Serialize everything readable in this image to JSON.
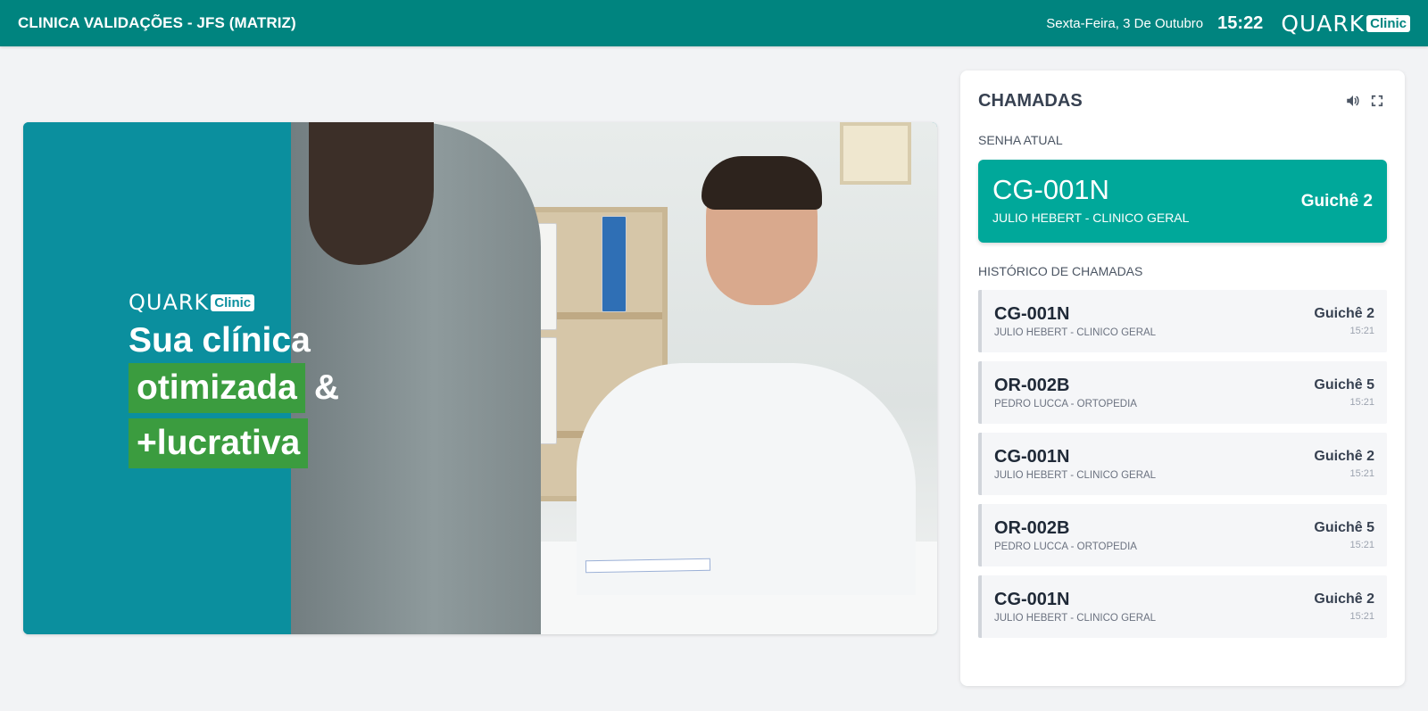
{
  "header": {
    "clinic_name": "CLINICA VALIDAÇÕES - JFS (MATRIZ)",
    "date": "Sexta-Feira, 3 De Outubro",
    "time": "15:22",
    "logo_word": "QUARK",
    "logo_pill": "Clinic"
  },
  "banner": {
    "logo_word": "QUARK",
    "logo_pill": "Clinic",
    "line1": "Sua clínica",
    "line2_highlight": "otimizada",
    "line2_suffix": "&",
    "line3_highlight": "+lucrativa"
  },
  "calls": {
    "title": "CHAMADAS",
    "current_label": "SENHA ATUAL",
    "current": {
      "code": "CG-001N",
      "doctor": "JULIO HEBERT - CLINICO GERAL",
      "window": "Guichê 2"
    },
    "history_label": "HISTÓRICO DE CHAMADAS",
    "history": [
      {
        "code": "CG-001N",
        "doctor": "JULIO HEBERT - CLINICO GERAL",
        "window": "Guichê 2",
        "time": "15:21"
      },
      {
        "code": "OR-002B",
        "doctor": "PEDRO LUCCA - ORTOPEDIA",
        "window": "Guichê 5",
        "time": "15:21"
      },
      {
        "code": "CG-001N",
        "doctor": "JULIO HEBERT - CLINICO GERAL",
        "window": "Guichê 2",
        "time": "15:21"
      },
      {
        "code": "OR-002B",
        "doctor": "PEDRO LUCCA - ORTOPEDIA",
        "window": "Guichê 5",
        "time": "15:21"
      },
      {
        "code": "CG-001N",
        "doctor": "JULIO HEBERT - CLINICO GERAL",
        "window": "Guichê 2",
        "time": "15:21"
      }
    ]
  },
  "icons": {
    "sound": "volume-icon",
    "fullscreen": "fullscreen-icon"
  },
  "colors": {
    "header_bg": "#00847f",
    "current_card_bg": "#00a89a",
    "banner_bg": "#0b8f9e",
    "highlight_green": "#3b9c3f"
  }
}
